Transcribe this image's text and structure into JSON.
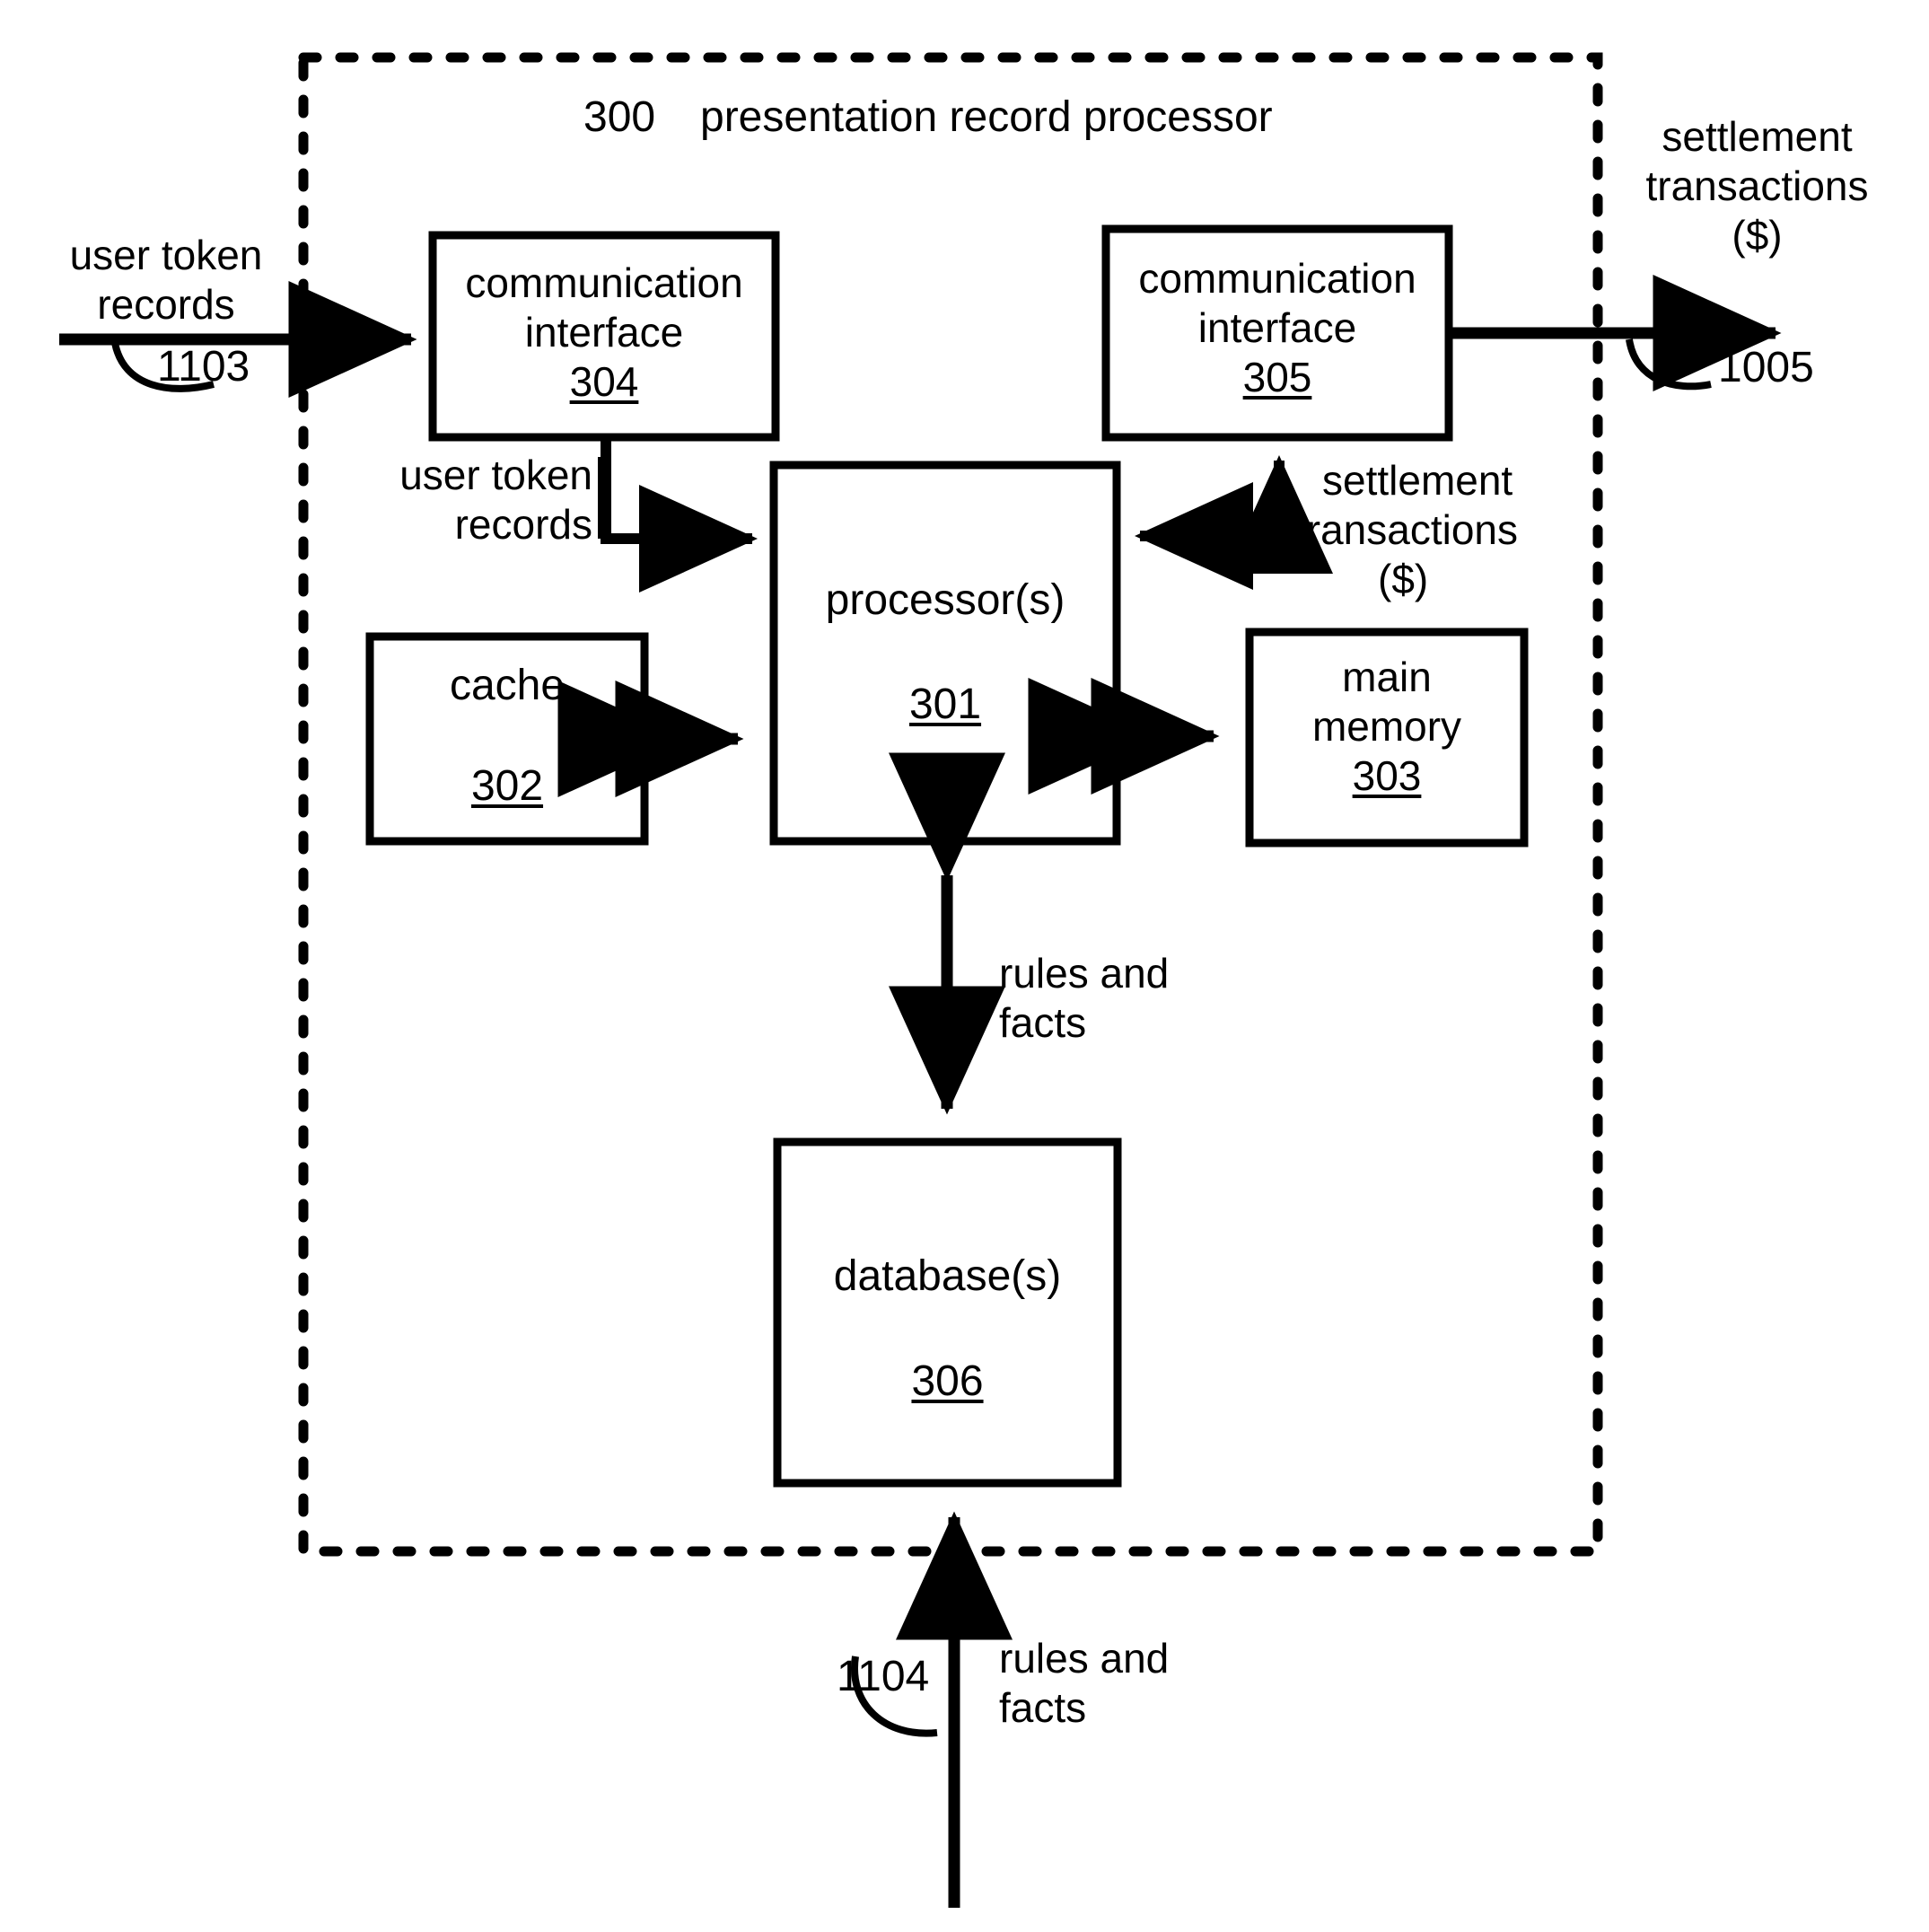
{
  "figure": {
    "type": "patent-block-diagram",
    "outer_container": {
      "ref": "300",
      "label": "presentation record processor",
      "border_style": "dashed"
    },
    "blocks": [
      {
        "id": "comm-interface-304",
        "name": "communication interface",
        "line1": "communication",
        "line2": "interface",
        "ref": "304"
      },
      {
        "id": "comm-interface-305",
        "name": "communication interface",
        "line1": "communication",
        "line2": "interface",
        "ref": "305"
      },
      {
        "id": "processor-301",
        "name": "processor(s)",
        "line1": "processor(s)",
        "ref": "301"
      },
      {
        "id": "cache-302",
        "name": "cache",
        "line1": "cache",
        "ref": "302"
      },
      {
        "id": "main-memory-303",
        "name": "main memory",
        "line1": "main",
        "line2": "memory",
        "ref": "303"
      },
      {
        "id": "databases-306",
        "name": "database(s)",
        "line1": "database(s)",
        "ref": "306"
      }
    ],
    "flow_labels": {
      "input_user_token_records": "user token\nrecords",
      "input_user_token_records_line1": "user token",
      "input_user_token_records_line2": "records",
      "input_ref": "1103",
      "internal_user_token_records_line1": "user token",
      "internal_user_token_records_line2": "records",
      "output_settlement_line1": "settlement",
      "output_settlement_line2": "transactions",
      "output_settlement_line3": "($)",
      "output_ref": "1005",
      "internal_settlement_line1": "settlement",
      "internal_settlement_line2": "transactions",
      "internal_settlement_line3": "($)",
      "rules_and_facts_internal_line1": "rules and",
      "rules_and_facts_internal_line2": "facts",
      "rules_and_facts_external_line1": "rules and",
      "rules_and_facts_external_line2": "facts",
      "external_rules_ref": "1104"
    },
    "colors": {
      "ink": "#000000",
      "background": "#ffffff"
    }
  }
}
